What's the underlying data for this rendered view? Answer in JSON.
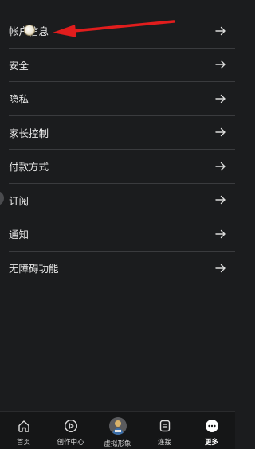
{
  "menu": {
    "items": [
      {
        "label": "帐户信息",
        "icon": "arrow-right-icon"
      },
      {
        "label": "安全",
        "icon": "arrow-right-icon"
      },
      {
        "label": "隐私",
        "icon": "arrow-right-icon"
      },
      {
        "label": "家长控制",
        "icon": "arrow-right-icon"
      },
      {
        "label": "付款方式",
        "icon": "arrow-right-icon"
      },
      {
        "label": "订阅",
        "icon": "arrow-right-icon"
      },
      {
        "label": "通知",
        "icon": "arrow-right-icon"
      },
      {
        "label": "无障碍功能",
        "icon": "arrow-right-icon"
      }
    ]
  },
  "annotation": {
    "color": "#e11d1d",
    "icon": "red-arrow-annotation"
  },
  "tabbar": {
    "tabs": [
      {
        "label": "首页",
        "icon": "home-icon",
        "active": false
      },
      {
        "label": "创作中心",
        "icon": "play-circle-icon",
        "active": false
      },
      {
        "label": "虚拟形象",
        "icon": "avatar-icon",
        "active": false
      },
      {
        "label": "连接",
        "icon": "document-icon",
        "active": false
      },
      {
        "label": "更多",
        "icon": "more-dots-icon",
        "active": true
      }
    ]
  },
  "colors": {
    "background": "#1b1c1e",
    "divider": "#3a3b3e",
    "text": "#e8e8e8",
    "tabbar_background": "#151617"
  }
}
